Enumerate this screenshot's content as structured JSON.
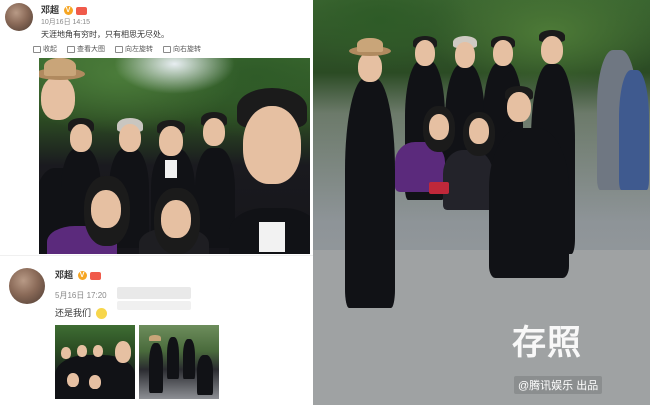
{
  "post_top": {
    "username": "邓超",
    "time": "10月16日 14:15",
    "text": "天涯地角有穷时，只有相思无尽处。",
    "toolbar": [
      {
        "label": "收起"
      },
      {
        "label": "查看大图"
      },
      {
        "label": "向左旋转"
      },
      {
        "label": "向右旋转"
      }
    ]
  },
  "post_bottom": {
    "username": "邓超",
    "time": "5月16日 17:20",
    "text": "还是我们"
  },
  "watermark": {
    "logo_text": "存照",
    "source_text": "@腾讯娱乐 出品"
  },
  "colors": {
    "verified_badge": "#f6a623",
    "member_badge": "#f05a4a",
    "username_text": "#333333",
    "meta_text": "#888888"
  }
}
